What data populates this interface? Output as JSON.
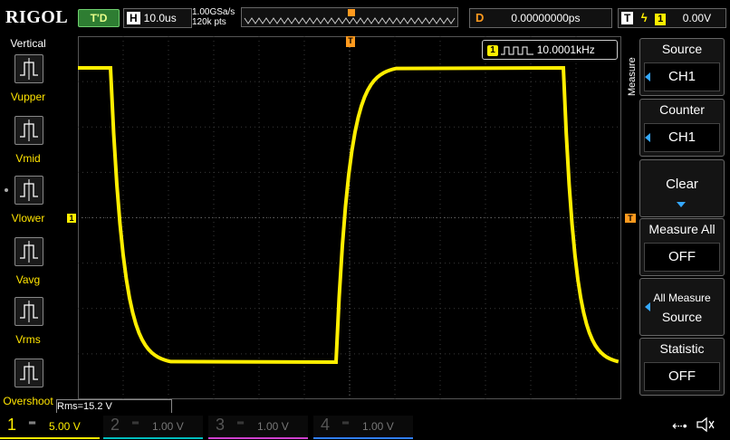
{
  "header": {
    "brand": "RIGOL",
    "run_status": "T'D",
    "timebase_key": "H",
    "timebase_value": "10.0us",
    "sample_rate": "1.00GSa/s",
    "memory_depth": "120k pts",
    "delay_key": "D",
    "delay_value": "0.00000000ps",
    "trigger_key": "T",
    "trigger_channel": "1",
    "trigger_level": "0.00V"
  },
  "left_menu": {
    "title": "Vertical",
    "items": [
      {
        "label": "Vupper",
        "icon": "vupper-icon"
      },
      {
        "label": "Vmid",
        "icon": "vmid-icon"
      },
      {
        "label": "Vlower",
        "icon": "vlower-icon"
      },
      {
        "label": "Vavg",
        "icon": "vavg-icon"
      },
      {
        "label": "Vrms",
        "icon": "vrms-icon"
      },
      {
        "label": "Overshoot",
        "icon": "overshoot-icon"
      }
    ]
  },
  "display": {
    "counter_channel": "1",
    "counter_value": "10.0001kHz",
    "trigger_marker": "T",
    "ch1_marker": "1",
    "level_marker": "T",
    "measurement": "Rms=15.2 V",
    "waveform_color": "#ffee00"
  },
  "right_menu": {
    "tab": "Measure",
    "source_title": "Source",
    "source_value": "CH1",
    "counter_title": "Counter",
    "counter_value": "CH1",
    "clear_label": "Clear",
    "measure_all_title": "Measure All",
    "measure_all_value": "OFF",
    "all_measure_title": "All Measure",
    "all_measure_value": "Source",
    "statistic_title": "Statistic",
    "statistic_value": "OFF"
  },
  "channels": [
    {
      "num": "1",
      "scale": "5.00 V",
      "color": "#ffee00",
      "active": true
    },
    {
      "num": "2",
      "scale": "1.00 V",
      "color": "#00c0c0",
      "active": false
    },
    {
      "num": "3",
      "scale": "1.00 V",
      "color": "#d040d0",
      "active": false
    },
    {
      "num": "4",
      "scale": "1.00 V",
      "color": "#3080ff",
      "active": false
    }
  ]
}
